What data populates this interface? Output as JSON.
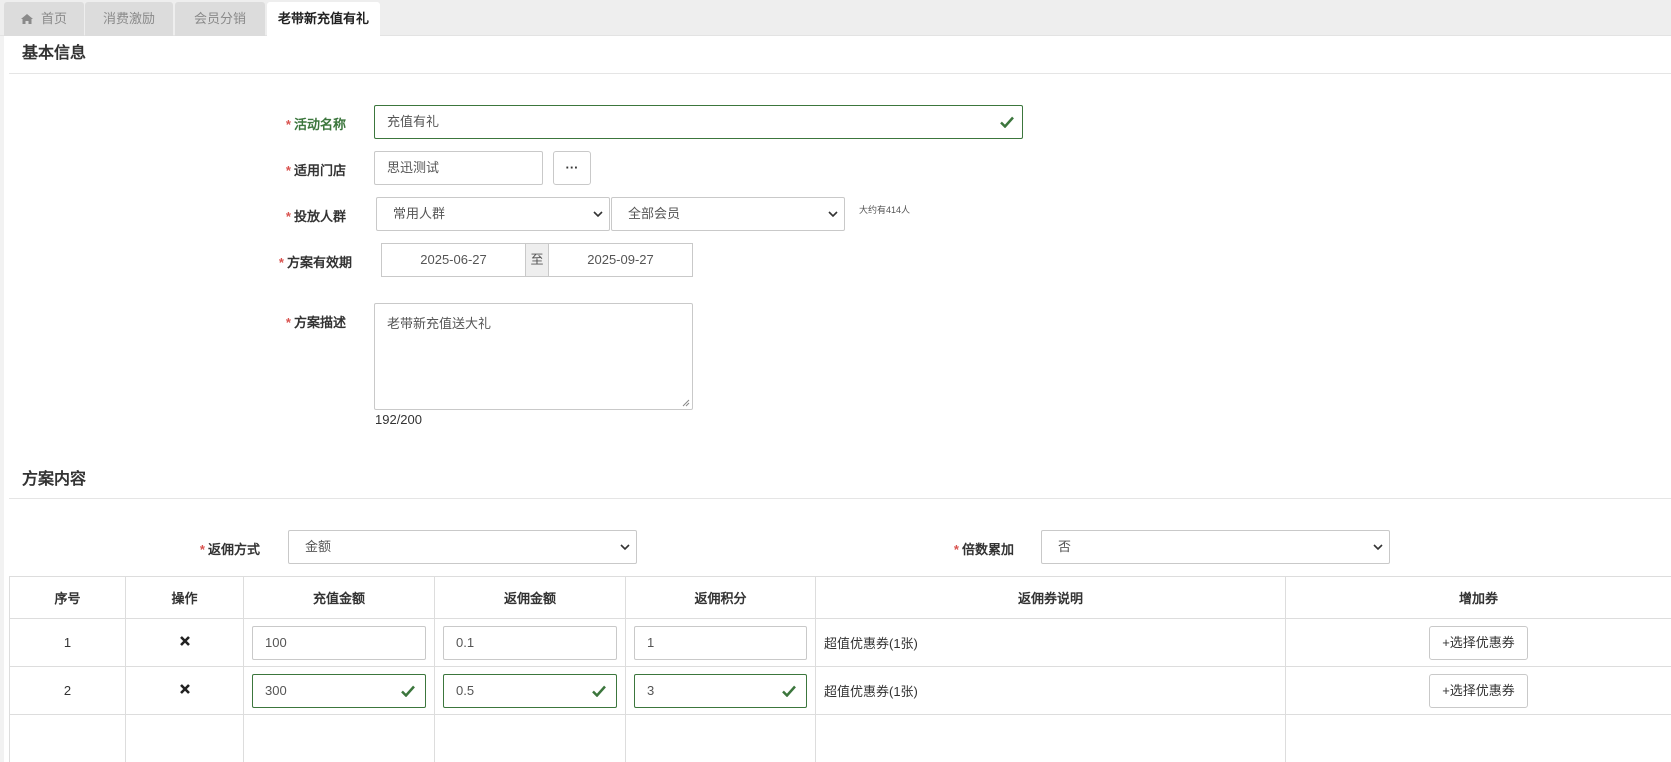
{
  "tabs": [
    {
      "label": "首页",
      "icon": "home-icon"
    },
    {
      "label": "消费激励"
    },
    {
      "label": "会员分销"
    },
    {
      "label": "老带新充值有礼",
      "active": true
    }
  ],
  "basic_info": {
    "title": "基本信息",
    "activity_name": {
      "label": "活动名称",
      "value": "充值有礼",
      "status": "valid"
    },
    "store": {
      "label": "适用门店",
      "value": "思迅测试",
      "more_button": "···"
    },
    "audience": {
      "label": "投放人群",
      "group_value": "常用人群",
      "member_value": "全部会员",
      "hint": "大约有414人"
    },
    "validity": {
      "label": "方案有效期",
      "start": "2025-06-27",
      "separator": "至",
      "end": "2025-09-27"
    },
    "description": {
      "label": "方案描述",
      "value": "老带新充值送大礼",
      "counter": "192/200"
    }
  },
  "plan_content": {
    "title": "方案内容",
    "rebate_method": {
      "label": "返佣方式",
      "value": "金额"
    },
    "multiple_stack": {
      "label": "倍数累加",
      "value": "否"
    },
    "table": {
      "headers": [
        "序号",
        "操作",
        "充值金额",
        "返佣金额",
        "返佣积分",
        "返佣券说明",
        "增加券"
      ],
      "rows": [
        {
          "index": "1",
          "recharge": "100",
          "rebate_amount": "0.1",
          "rebate_points": "1",
          "coupon_desc": "超值优惠券(1张)",
          "button": "+选择优惠券",
          "valid": false
        },
        {
          "index": "2",
          "recharge": "300",
          "rebate_amount": "0.5",
          "rebate_points": "3",
          "coupon_desc": "超值优惠券(1张)",
          "button": "+选择优惠券",
          "valid": true
        }
      ]
    }
  },
  "colors": {
    "required": "#d9534f",
    "success": "#3c763d",
    "border": "#c9c9c9"
  }
}
